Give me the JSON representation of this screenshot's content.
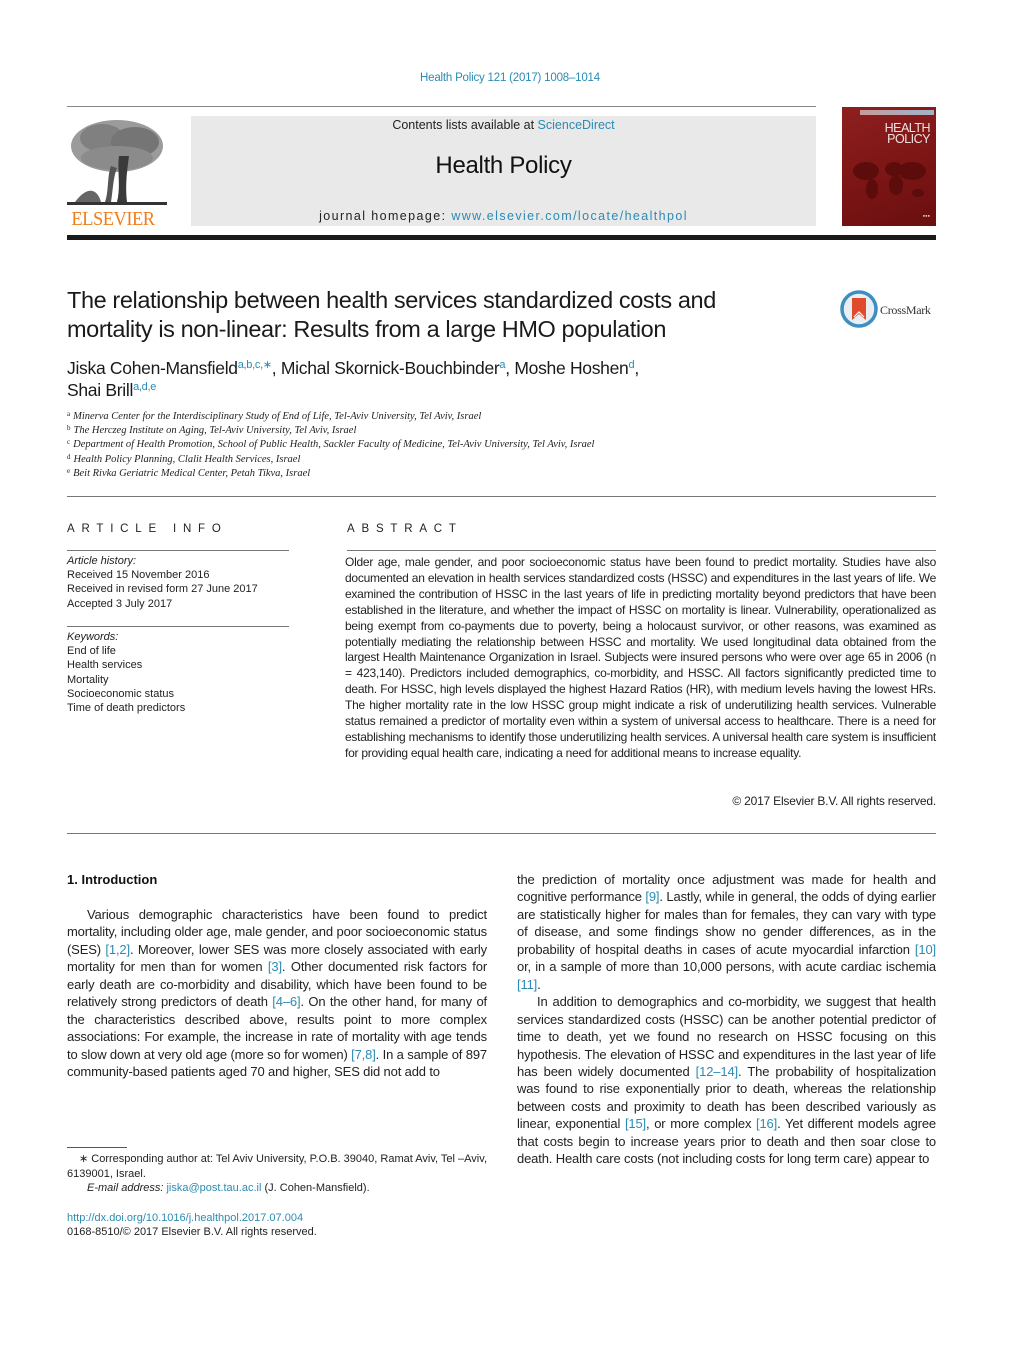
{
  "header": {
    "journal_ref": "Health Policy 121 (2017) 1008–1014",
    "publisher_logo_text": "ELSEVIER",
    "contents_prefix": "Contents lists available at ",
    "contents_link": "ScienceDirect",
    "journal_title": "Health Policy",
    "homepage_prefix": "journal homepage: ",
    "homepage_link": "www.elsevier.com/locate/healthpol",
    "cover": {
      "title_line1": "HEALTH",
      "title_line2": "POLICY"
    },
    "colors": {
      "link": "#2b8bb4",
      "elsevier_orange": "#f07d1b",
      "cover_red": "#7a1414"
    }
  },
  "article": {
    "title": "The relationship between health services standardized costs and mortality is non-linear: Results from a large HMO population",
    "crossmark_label": "CrossMark",
    "authors": [
      {
        "name": "Jiska Cohen-Mansfield",
        "sup": "a,b,c,∗",
        "sep": ", "
      },
      {
        "name": "Michal Skornick-Bouchbinder",
        "sup": "a",
        "sep": ", "
      },
      {
        "name": "Moshe Hoshen",
        "sup": "d",
        "sep": ","
      },
      {
        "name": "Shai Brill",
        "sup": "a,d,e",
        "sep": ""
      }
    ],
    "affiliations": [
      {
        "key": "a",
        "text": "Minerva Center for the Interdisciplinary Study of End of Life, Tel-Aviv University, Tel Aviv, Israel"
      },
      {
        "key": "b",
        "text": "The Herczeg Institute on Aging, Tel-Aviv University, Tel Aviv, Israel"
      },
      {
        "key": "c",
        "text": "Department of Health Promotion, School of Public Health, Sackler Faculty of Medicine, Tel-Aviv University, Tel Aviv, Israel"
      },
      {
        "key": "d",
        "text": "Health Policy Planning, Clalit Health Services, Israel"
      },
      {
        "key": "e",
        "text": "Beit Rivka Geriatric Medical Center, Petah Tikva, Israel"
      }
    ]
  },
  "article_info": {
    "heading": "ARTICLE INFO",
    "history_label": "Article history:",
    "history": [
      "Received 15 November 2016",
      "Received in revised form 27 June 2017",
      "Accepted 3 July 2017"
    ],
    "keywords_label": "Keywords:",
    "keywords": [
      "End of life",
      "Health services",
      "Mortality",
      "Socioeconomic status",
      "Time of death predictors"
    ]
  },
  "abstract": {
    "heading": "ABSTRACT",
    "text": "Older age, male gender, and poor socioeconomic status have been found to predict mortality. Studies have also documented an elevation in health services standardized costs (HSSC) and expenditures in the last years of life. We examined the contribution of HSSC in the last years of life in predicting mortality beyond predictors that have been established in the literature, and whether the impact of HSSC on mortality is linear. Vulnerability, operationalized as being exempt from co-payments due to poverty, being a holocaust survivor, or other reasons, was examined as potentially mediating the relationship between HSSC and mortality. We used longitudinal data obtained from the largest Health Maintenance Organization in Israel. Subjects were insured persons who were over age 65 in 2006 (n = 423,140). Predictors included demographics, co-morbidity, and HSSC. All factors significantly predicted time to death. For HSSC, high levels displayed the highest Hazard Ratios (HR), with medium levels having the lowest HRs. The higher mortality rate in the low HSSC group might indicate a risk of underutilizing health services. Vulnerable status remained a predictor of mortality even within a system of universal access to healthcare. There is a need for establishing mechanisms to identify those underutilizing health services. A universal health care system is insufficient for providing equal health care, indicating a need for additional means to increase equality.",
    "copyright": "© 2017 Elsevier B.V. All rights reserved."
  },
  "body": {
    "section_heading": "1.  Introduction",
    "left_column": [
      {
        "t": "Various demographic characteristics have been found to predict mortality, including older age, male gender, and poor socioeconomic status (SES) "
      },
      {
        "c": "[1,2]"
      },
      {
        "t": ". Moreover, lower SES was more closely associated with early mortality for men than for women "
      },
      {
        "c": "[3]"
      },
      {
        "t": ". Other documented risk factors for early death are co-morbidity and disability, which have been found to be relatively strong predictors of death "
      },
      {
        "c": "[4–6]"
      },
      {
        "t": ". On the other hand, for many of the characteristics described above, results point to more complex associations: For example, the increase in rate of mortality with age tends to slow down at very old age (more so for women) "
      },
      {
        "c": "[7,8]"
      },
      {
        "t": ". In a sample of 897 community-based patients aged 70 and higher, SES did not add to"
      }
    ],
    "right_column_p1": [
      {
        "t": "the prediction of mortality once adjustment was made for health and cognitive performance "
      },
      {
        "c": "[9]"
      },
      {
        "t": ". Lastly, while in general, the odds of dying earlier are statistically higher for males than for females, they can vary with type of disease, and some findings show no gender differences, as in the probability of hospital deaths in cases of acute myocardial infarction "
      },
      {
        "c": "[10]"
      },
      {
        "t": " or, in a sample of more than 10,000 persons, with acute cardiac ischemia "
      },
      {
        "c": "[11]"
      },
      {
        "t": "."
      }
    ],
    "right_column_p2": [
      {
        "t": "In addition to demographics and co-morbidity, we suggest that health services standardized costs (HSSC) can be another potential predictor of time to death, yet we found no research on HSSC focusing on this hypothesis. The elevation of HSSC and expenditures in the last year of life has been widely documented "
      },
      {
        "c": "[12–14]"
      },
      {
        "t": ". The probability of hospitalization was found to rise exponentially prior to death, whereas the relationship between costs and proximity to death has been described variously as linear, exponential "
      },
      {
        "c": "[15]"
      },
      {
        "t": ", or more complex "
      },
      {
        "c": "[16]"
      },
      {
        "t": ". Yet different models agree that costs begin to increase years prior to death and then soar close to death. Health care costs (not including costs for long term care) appear to"
      }
    ]
  },
  "footer": {
    "corresponding": "∗  Corresponding author at: Tel Aviv University, P.O.B. 39040, Ramat Aviv, Tel –Aviv, 6139001, Israel.",
    "email_label": "E-mail address: ",
    "email": "jiska@post.tau.ac.il",
    "email_suffix": " (J. Cohen-Mansfield).",
    "doi": "http://dx.doi.org/10.1016/j.healthpol.2017.07.004",
    "issn": "0168-8510/© 2017 Elsevier B.V. All rights reserved."
  }
}
